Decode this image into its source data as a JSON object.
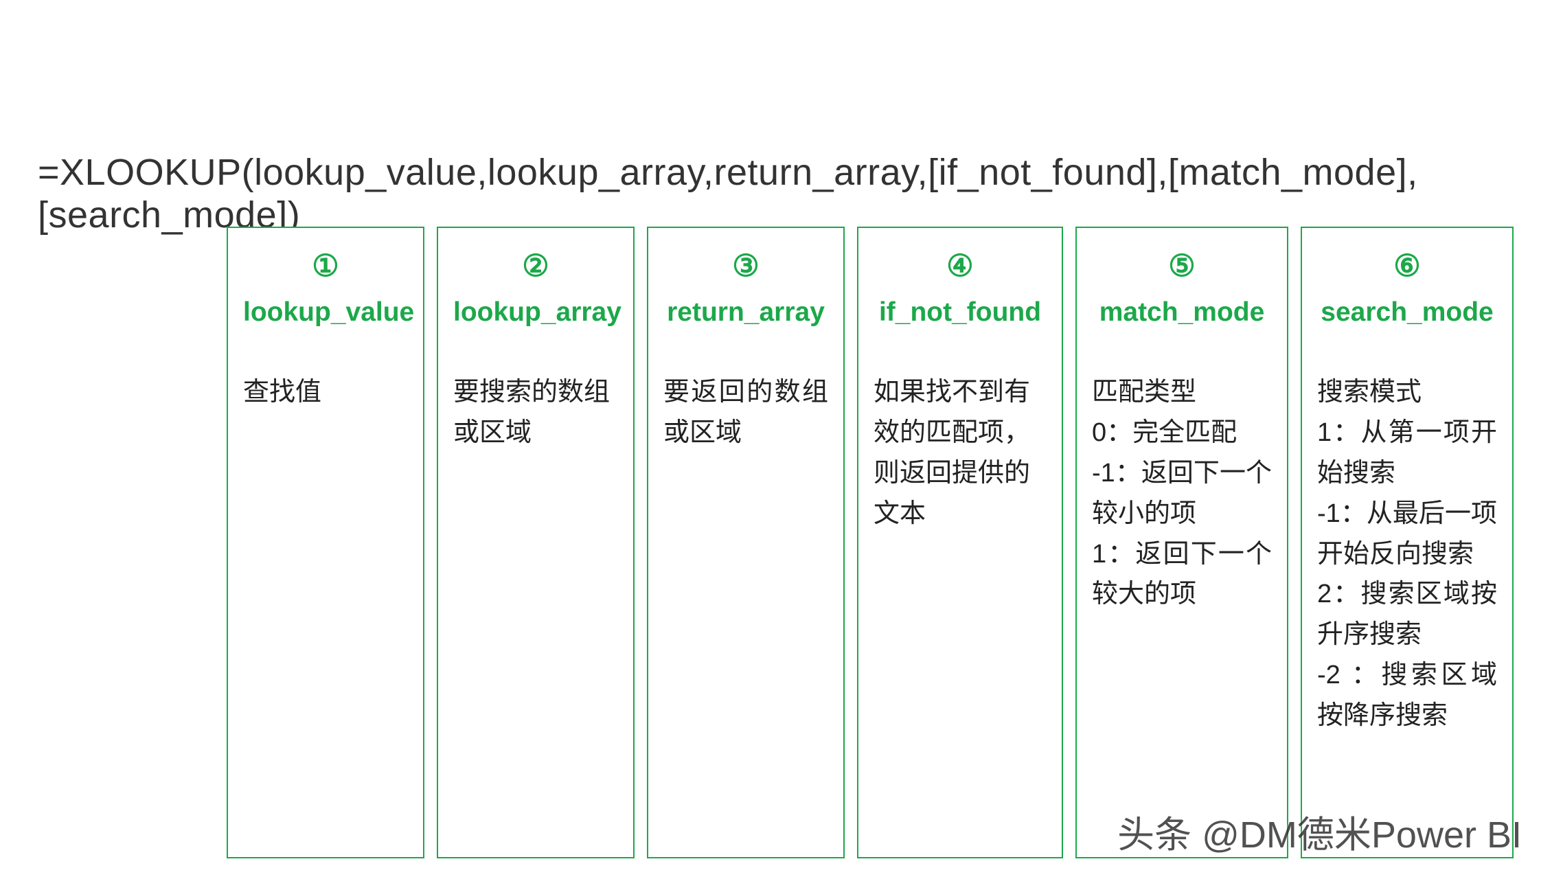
{
  "formula": "=XLOOKUP(lookup_value,lookup_array,return_array,[if_not_found],[match_mode],[search_mode])",
  "cards": [
    {
      "number": "①",
      "title": "lookup_value",
      "desc": "查找值"
    },
    {
      "number": "②",
      "title": "lookup_array",
      "desc": "要搜索的数组或区域"
    },
    {
      "number": "③",
      "title": "return_array",
      "desc": "要返回的数组或区域"
    },
    {
      "number": "④",
      "title": "if_not_found",
      "desc": "如果找不到有效的匹配项，则返回提供的文本"
    },
    {
      "number": "⑤",
      "title": "match_mode",
      "desc": "匹配类型\n0：完全匹配\n-1：返回下一个较小的项\n1：返回下一个较大的项"
    },
    {
      "number": "⑥",
      "title": "search_mode",
      "desc": "搜索模式\n1：从第一项开始搜索\n-1：从最后一项开始反向搜索\n2：搜索区域按升序搜索\n-2 ：搜索区域按降序搜索"
    }
  ],
  "watermark": "头条 @DM德米Power BI"
}
